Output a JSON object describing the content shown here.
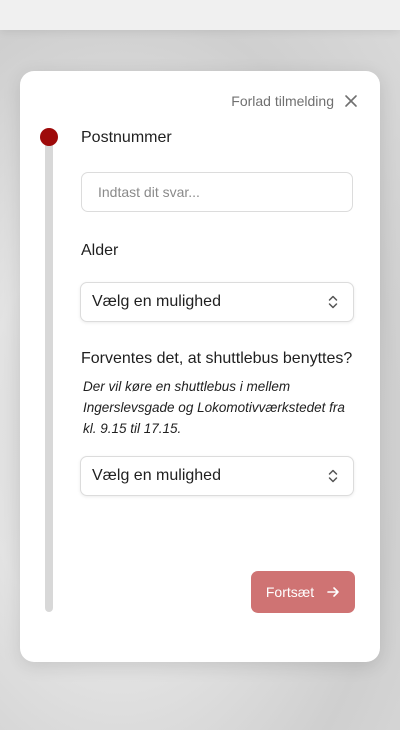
{
  "header": {
    "leave_label": "Forlad tilmelding",
    "close_icon": "close-icon"
  },
  "progress": {
    "current_step": 1,
    "accent_color": "#9e0a0a"
  },
  "form": {
    "postal": {
      "label": "Postnummer",
      "placeholder": "Indtast dit svar...",
      "value": ""
    },
    "age": {
      "label": "Alder",
      "selected": "Vælg en mulighed"
    },
    "shuttle": {
      "label": "Forventes det, at shuttlebus benyttes?",
      "note": "Der vil køre en shuttlebus i mellem Ingerslevsgade og Lokomotivværkstedet fra kl. 9.15 til 17.15.",
      "selected": "Vælg en mulighed"
    }
  },
  "footer": {
    "continue_label": "Fortsæt",
    "continue_color": "#cf7373"
  }
}
